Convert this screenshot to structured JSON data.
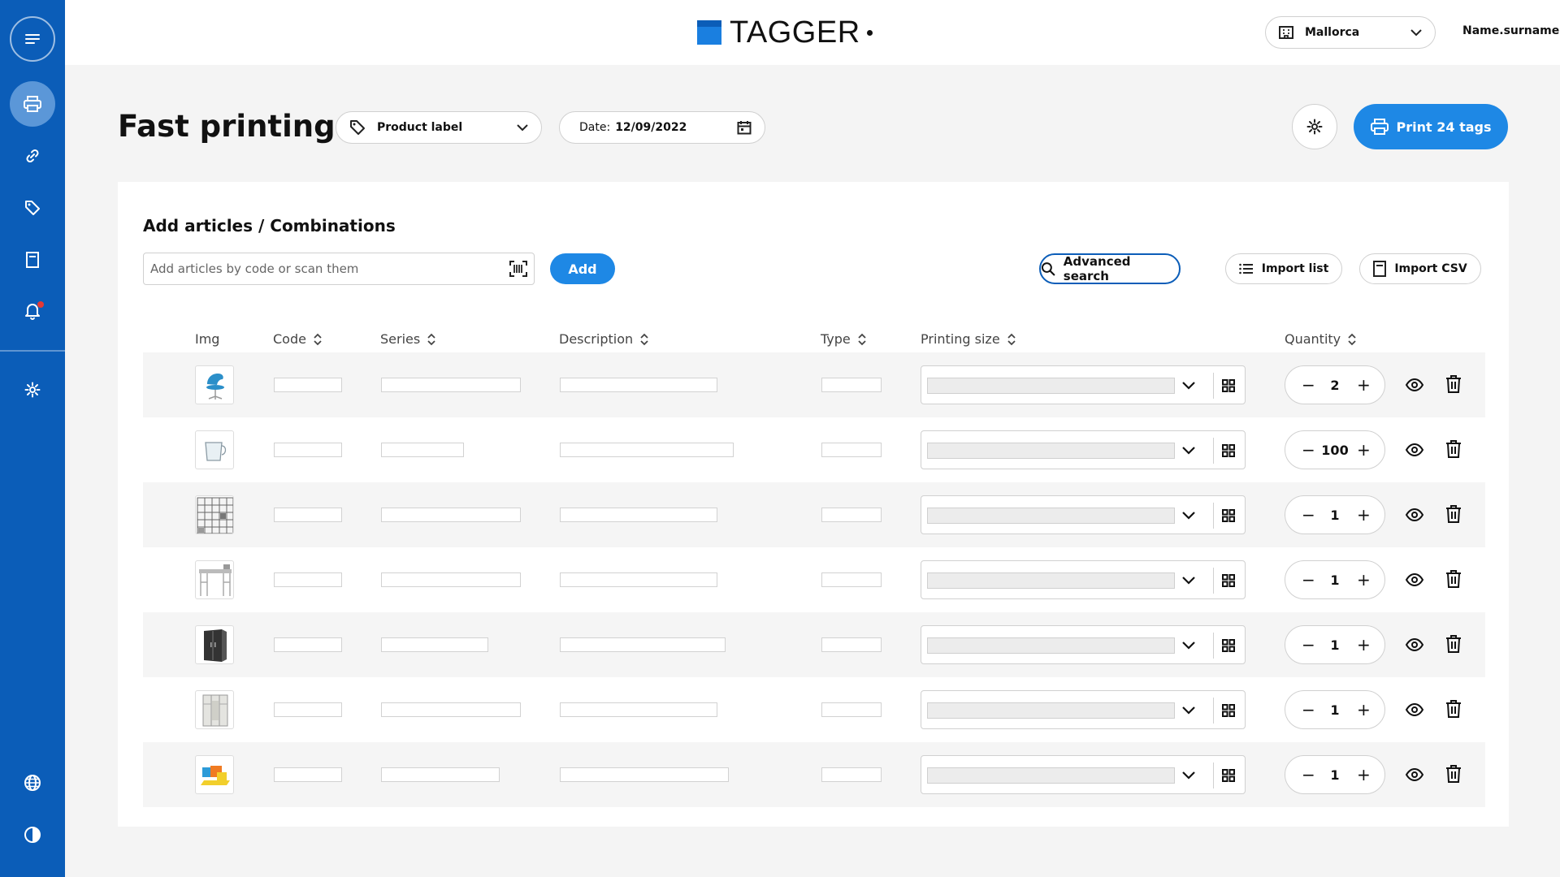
{
  "app": {
    "logo_text": "TAGGER",
    "store": "Mallorca",
    "user": "Name.surname"
  },
  "sidebar": {
    "items": [
      {
        "icon": "menu-icon"
      },
      {
        "icon": "printer-icon",
        "active": true
      },
      {
        "icon": "link-icon"
      },
      {
        "icon": "tag-icon"
      },
      {
        "icon": "document-icon"
      },
      {
        "icon": "bell-icon",
        "badge": true
      },
      {
        "icon": "gear-icon"
      },
      {
        "icon": "globe-icon"
      },
      {
        "icon": "contrast-icon"
      }
    ]
  },
  "page": {
    "title": "Fast printing",
    "label_type": "Product label",
    "date_label": "Date:",
    "date_value": "12/09/2022",
    "print_button": "Print 24 tags"
  },
  "card": {
    "title": "Add articles / Combinations",
    "search_placeholder": "Add articles by code or scan them",
    "add_button": "Add",
    "advanced_search": "Advanced search",
    "import_list": "Import list",
    "import_csv": "Import CSV"
  },
  "table": {
    "columns": {
      "img": "Img",
      "code": "Code",
      "series": "Series",
      "description": "Description",
      "type": "Type",
      "printing_size": "Printing size",
      "quantity": "Quantity"
    },
    "rows": [
      {
        "product": "chair",
        "quantity": "2"
      },
      {
        "product": "glass-mug",
        "quantity": "100"
      },
      {
        "product": "grid-shelf",
        "quantity": "1"
      },
      {
        "product": "desk",
        "quantity": "1"
      },
      {
        "product": "dark-wardrobe",
        "quantity": "1"
      },
      {
        "product": "light-wardrobe",
        "quantity": "1"
      },
      {
        "product": "storage-boxes",
        "quantity": "1"
      }
    ]
  },
  "colors": {
    "sidebar": "#0b5db8",
    "accent": "#1e88e5",
    "background": "#f4f4f4"
  }
}
